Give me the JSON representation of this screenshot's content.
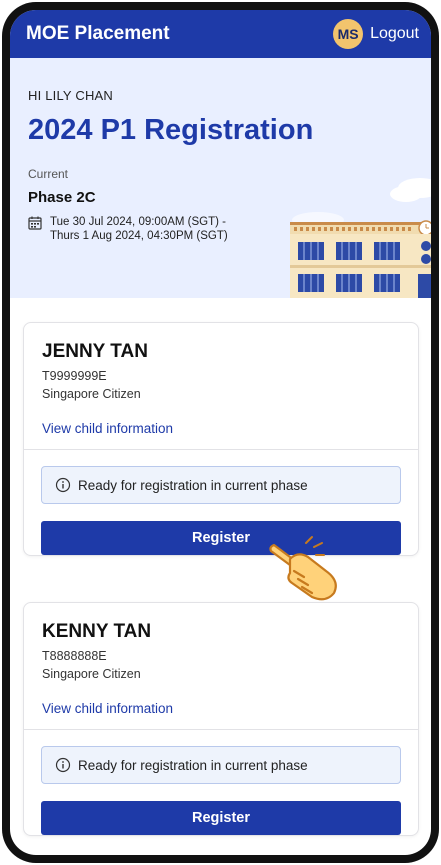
{
  "app_bar": {
    "title": "MOE Placement",
    "avatar_initials": "MS",
    "logout_label": "Logout"
  },
  "hero": {
    "greeting": "HI LILY CHAN",
    "title": "2024 P1 Registration",
    "current_label": "Current",
    "phase": "Phase 2C",
    "date_line_1": "Tue 30 Jul 2024, 09:00AM (SGT) -",
    "date_line_2": "Thurs 1 Aug 2024, 04:30PM (SGT)",
    "icon": "calendar-icon",
    "illustration": "school-building"
  },
  "children": [
    {
      "name": "JENNY TAN",
      "id": "T9999999E",
      "citizenship": "Singapore Citizen",
      "view_link": "View child information",
      "status": "Ready for registration in current phase",
      "register_label": "Register"
    },
    {
      "name": "KENNY TAN",
      "id": "T8888888E",
      "citizenship": "Singapore Citizen",
      "view_link": "View child information",
      "status": "Ready for registration in current phase",
      "register_label": "Register"
    }
  ],
  "colors": {
    "primary": "#1e3aa8",
    "hero_bg": "#e9efff",
    "avatar_bg": "#f2c46d",
    "status_bg": "#eef3fc",
    "status_border": "#b9c9ec"
  }
}
